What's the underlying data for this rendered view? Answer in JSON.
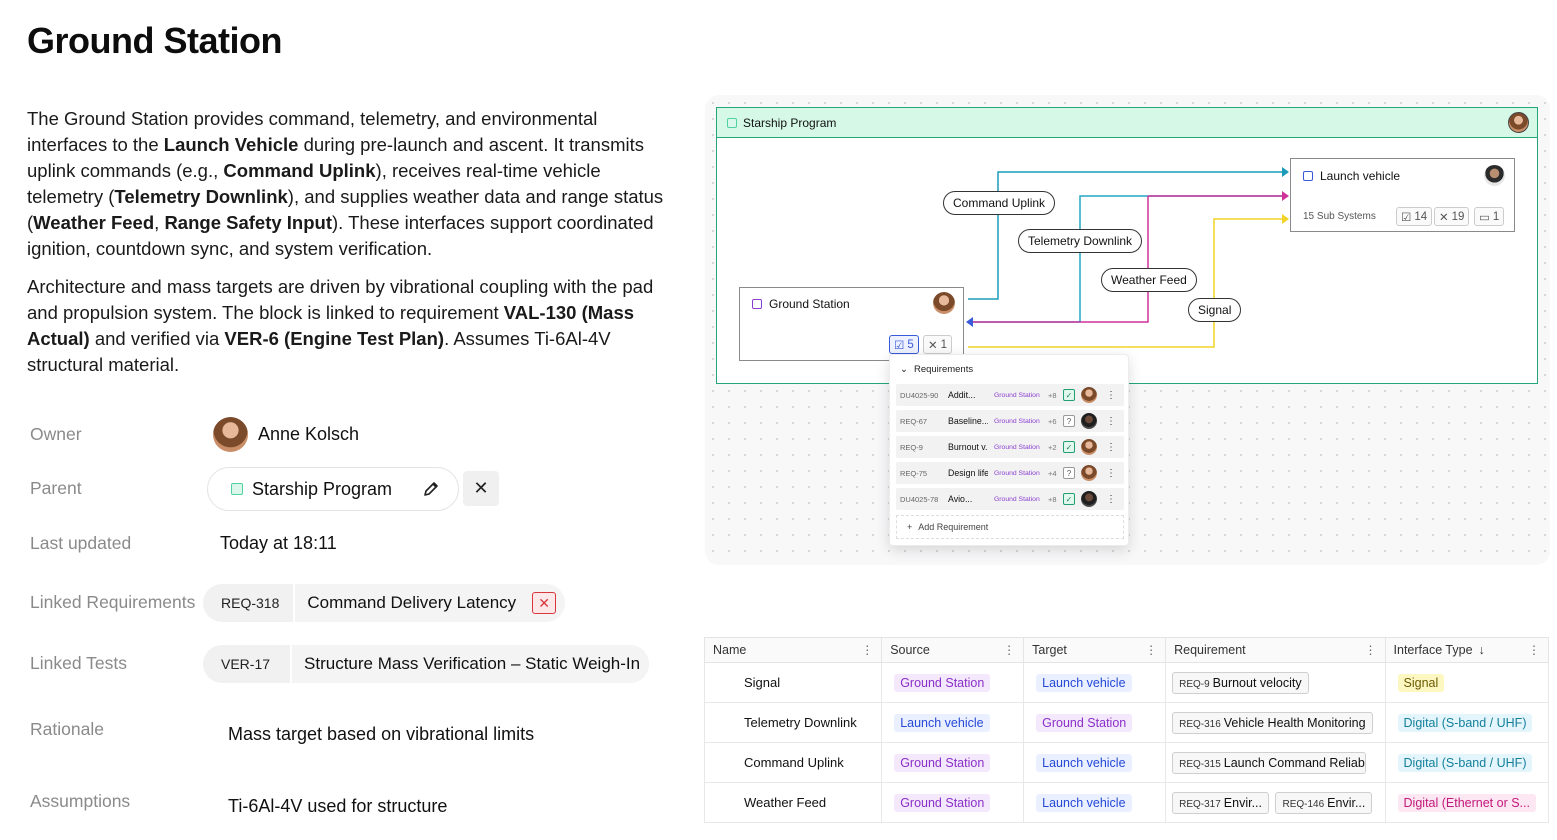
{
  "page": {
    "title": "Ground Station",
    "desc1": {
      "t1": "The Ground Station provides command, telemetry, and environmental interfaces to the ",
      "b1": "Launch Vehicle",
      "t2": " during pre-launch and ascent. It transmits uplink commands (e.g., ",
      "b2": "Command Uplink",
      "t3": "), receives real-time vehicle telemetry (",
      "b3": "Telemetry Downlink",
      "t4": "), and supplies weather data and range status (",
      "b4": "Weather Feed",
      "t5": ", ",
      "b5": "Range Safety Input",
      "t6": "). These interfaces support coordinated ignition, countdown sync, and system verification."
    },
    "desc2": {
      "t1": "Architecture and mass targets are driven by vibrational coupling with the pad and propulsion system. The block is linked to requirement ",
      "b1": "VAL-130 (Mass Actual)",
      "t2": " and verified via ",
      "b2": "VER-6 (Engine Test Plan)",
      "t3": ". Assumes Ti-6Al-4V structural material."
    }
  },
  "props": {
    "owner_label": "Owner",
    "owner_name": "Anne Kolsch",
    "parent_label": "Parent",
    "parent_value": "Starship Program",
    "updated_label": "Last updated",
    "updated_value": "Today at 18:11",
    "linked_req_label": "Linked Requirements",
    "linked_req_id": "REQ-318",
    "linked_req_name": "Command Delivery Latency",
    "linked_tests_label": "Linked Tests",
    "linked_test_id": "VER-17",
    "linked_test_name": "Structure Mass Verification – Static Weigh-In",
    "rationale_label": "Rationale",
    "rationale_value": "Mass target based on vibrational limits",
    "assumptions_label": "Assumptions",
    "assumptions_value": "Ti-6Al-4V used for structure"
  },
  "diagram": {
    "frame_title": "Starship Program",
    "launch_vehicle": {
      "title": "Launch vehicle",
      "subsystems": "15 Sub Systems",
      "badge1": "14",
      "badge2": "19",
      "badge3": "1"
    },
    "ground_station": {
      "title": "Ground Station",
      "badge_req": "5",
      "badge_link": "1"
    },
    "edges": [
      {
        "label": "Command Uplink",
        "color": "#1c9bb8"
      },
      {
        "label": "Telemetry Downlink",
        "color": "#22a6c4"
      },
      {
        "label": "Weather Feed",
        "color": "#d0329a"
      },
      {
        "label": "Signal",
        "color": "#f1d427"
      }
    ],
    "popup": {
      "header": "Requirements",
      "rows": [
        {
          "id": "DU4025-90",
          "name": "Addit...",
          "source": "Ground Station",
          "plus": "+8",
          "status": "check"
        },
        {
          "id": "REQ-67",
          "name": "Baseline...",
          "source": "Ground Station",
          "plus": "+6",
          "status": "?"
        },
        {
          "id": "REQ-9",
          "name": "Burnout v...",
          "source": "Ground Station",
          "plus": "+2",
          "status": "check"
        },
        {
          "id": "REQ-75",
          "name": "Design life",
          "source": "Ground Station",
          "plus": "+4",
          "status": "?"
        },
        {
          "id": "DU4025-78",
          "name": "Avio...",
          "source": "Ground Station",
          "plus": "+8",
          "status": "check"
        }
      ],
      "add_label": "Add Requirement"
    }
  },
  "table": {
    "headers": [
      "Name",
      "Source",
      "Target",
      "Requirement",
      "Interface Type"
    ],
    "rows": [
      {
        "name": "Signal",
        "source": "Ground Station",
        "target": "Launch vehicle",
        "req_id": "REQ-9",
        "req_name": "Burnout velocity",
        "req2_id": "",
        "req2_name": "",
        "iface": "Signal"
      },
      {
        "name": "Telemetry Downlink",
        "source": "Launch vehicle",
        "target": "Ground Station",
        "req_id": "REQ-316",
        "req_name": "Vehicle Health Monitoring",
        "req2_id": "",
        "req2_name": "",
        "iface": "Digital (S-band / UHF)"
      },
      {
        "name": "Command Uplink",
        "source": "Ground Station",
        "target": "Launch vehicle",
        "req_id": "REQ-315",
        "req_name": "Launch Command Reliab...",
        "req2_id": "",
        "req2_name": "",
        "iface": "Digital (S-band / UHF)"
      },
      {
        "name": "Weather Feed",
        "source": "Ground Station",
        "target": "Launch vehicle",
        "req_id": "REQ-317",
        "req_name": "Envir...",
        "req2_id": "REQ-146",
        "req2_name": "Envir...",
        "iface": "Digital (Ethernet or S..."
      }
    ]
  },
  "colors": {
    "accent_green": "#25a67a",
    "cyan": "#1c9bb8",
    "magenta": "#d0329a",
    "yellow": "#f1d427",
    "danger": "#d9363e"
  }
}
